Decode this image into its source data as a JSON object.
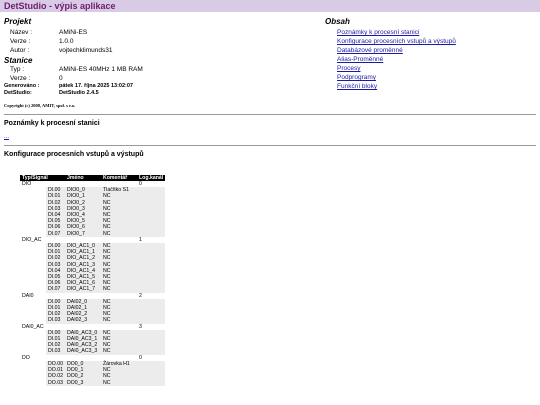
{
  "header": {
    "title": "DetStudio - výpis aplikace"
  },
  "project": {
    "heading": "Projekt",
    "name_label": "Název :",
    "name_value": "AMiNi-ES",
    "version_label": "Verze :",
    "version_value": "1.0.0",
    "author_label": "Autor :",
    "author_value": "vojtechklimunds31"
  },
  "station": {
    "heading": "Stanice",
    "type_label": "Typ :",
    "type_value": "AMiNi-ES 40MHz 1 MB RAM",
    "version_label": "Verze :",
    "version_value": "0"
  },
  "generated": {
    "generated_label": "Generováno :",
    "generated_value": "pátek 17. října 2025 13:02:07",
    "detstudio_label": "DetStudio:",
    "detstudio_value": "DetStudio 2.4.5"
  },
  "copyright": "Copyright (c) 2008, AMIT, spol. s r.o.",
  "contents": {
    "heading": "Obsah",
    "links": [
      "Poznámky k procesní stanici",
      "Konfigurace procesních vstupů a výstupů",
      "Databázové proměnné",
      "Alias-Proměnné",
      "Procesy",
      "Podprogramy",
      "Funkční bloky"
    ]
  },
  "notes": {
    "heading": "Poznámky k procesní stanici",
    "link": "..."
  },
  "io_config": {
    "heading": "Konfigurace procesních vstupů a výstupů",
    "columns": [
      "Typ/Signál",
      "Jméno",
      "Komentář",
      "Log.kanál"
    ],
    "rows": [
      {
        "kind": "grp",
        "c1": "DIO",
        "c2": "",
        "c3": "",
        "c4": "0"
      },
      {
        "kind": "row",
        "c1": "DI.00",
        "c2": "DIO0_0",
        "c3": "Tlačítko S1",
        "c4": ""
      },
      {
        "kind": "row",
        "c1": "DI.01",
        "c2": "DIO0_1",
        "c3": "NC",
        "c4": ""
      },
      {
        "kind": "row",
        "c1": "DI.02",
        "c2": "DIO0_2",
        "c3": "NC",
        "c4": ""
      },
      {
        "kind": "row",
        "c1": "DI.03",
        "c2": "DIO0_3",
        "c3": "NC",
        "c4": ""
      },
      {
        "kind": "row",
        "c1": "DI.04",
        "c2": "DIO0_4",
        "c3": "NC",
        "c4": ""
      },
      {
        "kind": "row",
        "c1": "DI.05",
        "c2": "DIO0_5",
        "c3": "NC",
        "c4": ""
      },
      {
        "kind": "row",
        "c1": "DI.06",
        "c2": "DIO0_6",
        "c3": "NC",
        "c4": ""
      },
      {
        "kind": "row",
        "c1": "DI.07",
        "c2": "DIO0_7",
        "c3": "NC",
        "c4": ""
      },
      {
        "kind": "grp",
        "c1": "DIO_AC",
        "c2": "",
        "c3": "",
        "c4": "1"
      },
      {
        "kind": "row",
        "c1": "DI.00",
        "c2": "DIO_AC1_0",
        "c3": "NC",
        "c4": ""
      },
      {
        "kind": "row",
        "c1": "DI.01",
        "c2": "DIO_AC1_1",
        "c3": "NC",
        "c4": ""
      },
      {
        "kind": "row",
        "c1": "DI.02",
        "c2": "DIO_AC1_2",
        "c3": "NC",
        "c4": ""
      },
      {
        "kind": "row",
        "c1": "DI.03",
        "c2": "DIO_AC1_3",
        "c3": "NC",
        "c4": ""
      },
      {
        "kind": "row",
        "c1": "DI.04",
        "c2": "DIO_AC1_4",
        "c3": "NC",
        "c4": ""
      },
      {
        "kind": "row",
        "c1": "DI.05",
        "c2": "DIO_AC1_5",
        "c3": "NC",
        "c4": ""
      },
      {
        "kind": "row",
        "c1": "DI.06",
        "c2": "DIO_AC1_6",
        "c3": "NC",
        "c4": ""
      },
      {
        "kind": "row",
        "c1": "DI.07",
        "c2": "DIO_AC1_7",
        "c3": "NC",
        "c4": ""
      },
      {
        "kind": "grp",
        "c1": "DAI0",
        "c2": "",
        "c3": "",
        "c4": "2"
      },
      {
        "kind": "row",
        "c1": "DI.00",
        "c2": "DAI02_0",
        "c3": "NC",
        "c4": ""
      },
      {
        "kind": "row",
        "c1": "DI.01",
        "c2": "DAI02_1",
        "c3": "NC",
        "c4": ""
      },
      {
        "kind": "row",
        "c1": "DI.02",
        "c2": "DAI02_2",
        "c3": "NC",
        "c4": ""
      },
      {
        "kind": "row",
        "c1": "DI.03",
        "c2": "DAI02_3",
        "c3": "NC",
        "c4": ""
      },
      {
        "kind": "grp",
        "c1": "DAI0_AC",
        "c2": "",
        "c3": "",
        "c4": "3"
      },
      {
        "kind": "row",
        "c1": "DI.00",
        "c2": "DAI0_AC3_0",
        "c3": "NC",
        "c4": ""
      },
      {
        "kind": "row",
        "c1": "DI.01",
        "c2": "DAI0_AC3_1",
        "c3": "NC",
        "c4": ""
      },
      {
        "kind": "row",
        "c1": "DI.02",
        "c2": "DAI0_AC3_2",
        "c3": "NC",
        "c4": ""
      },
      {
        "kind": "row",
        "c1": "DI.03",
        "c2": "DAI0_AC3_3",
        "c3": "NC",
        "c4": ""
      },
      {
        "kind": "grp",
        "c1": "DO",
        "c2": "",
        "c3": "",
        "c4": "0"
      },
      {
        "kind": "row",
        "c1": "DO.00",
        "c2": "DO0_0",
        "c3": "Žárovka H1",
        "c4": ""
      },
      {
        "kind": "row",
        "c1": "DO.01",
        "c2": "DO0_1",
        "c3": "NC",
        "c4": ""
      },
      {
        "kind": "row",
        "c1": "DO.02",
        "c2": "DO0_2",
        "c3": "NC",
        "c4": ""
      },
      {
        "kind": "row",
        "c1": "DO.03",
        "c2": "DO0_3",
        "c3": "NC",
        "c4": ""
      }
    ]
  }
}
